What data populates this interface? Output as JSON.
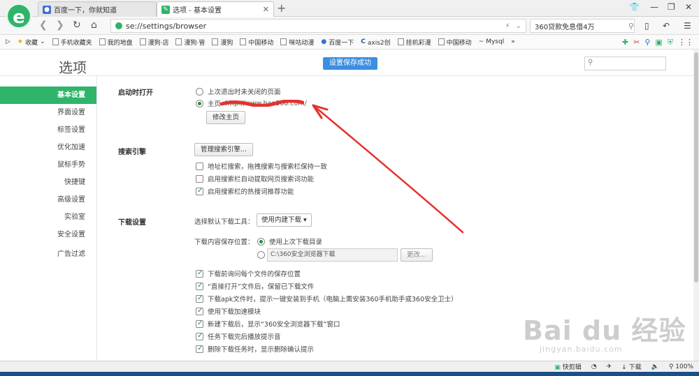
{
  "tabs": [
    {
      "label": "百度一下，你就知道",
      "active": false
    },
    {
      "label": "选项 - 基本设置",
      "active": true
    }
  ],
  "address": {
    "url": "se://settings/browser"
  },
  "search_box": {
    "text": "360贷款免息借4万"
  },
  "bookmarks": [
    "收藏",
    "手机收藏夹",
    "我的地盘",
    "漫狗·店",
    "漫狗·管",
    "漫狗",
    "中国移动",
    "咪咕动漫",
    "百度一下",
    "axis2创",
    "挂机彩漫",
    "中国移动",
    "Mysql"
  ],
  "page": {
    "title": "选项",
    "toast": "设置保存成功",
    "search_placeholder": ""
  },
  "sidebar": [
    {
      "label": "基本设置",
      "active": true
    },
    {
      "label": "界面设置",
      "active": false
    },
    {
      "label": "标签设置",
      "active": false
    },
    {
      "label": "优化加速",
      "active": false
    },
    {
      "label": "鼠标手势",
      "active": false
    },
    {
      "label": "快捷键",
      "active": false
    },
    {
      "label": "高级设置",
      "active": false
    },
    {
      "label": "实验室",
      "active": false
    },
    {
      "label": "安全设置",
      "active": false
    },
    {
      "label": "广告过滤",
      "active": false
    }
  ],
  "startup": {
    "title": "启动时打开",
    "option_restore": "上次退出时未关闭的页面",
    "option_home": "主页",
    "home_url": "http://www.hao360.com/",
    "modify_button": "修改主页"
  },
  "search_engine": {
    "title": "搜索引擎",
    "manage_button": "管理搜索引擎...",
    "options": [
      {
        "label": "地址栏搜索，拖拽搜索与搜索栏保持一致",
        "checked": false
      },
      {
        "label": "启用搜索栏自动提取网页搜索词功能",
        "checked": false
      },
      {
        "label": "启用搜索栏的热搜词推荐功能",
        "checked": true
      }
    ]
  },
  "download": {
    "title": "下载设置",
    "tool_label": "选择默认下载工具：",
    "tool_value": "使用内建下载",
    "location_label": "下载内容保存位置：",
    "location_last": "使用上次下载目录",
    "location_path": "C:\\360安全浏览器下载",
    "change_button": "更改...",
    "options": [
      {
        "label": "下载前询问每个文件的保存位置",
        "checked": true
      },
      {
        "label": "“直接打开”文件后，保留已下载文件",
        "checked": true
      },
      {
        "label": "下载apk文件时，提示一键安装到手机（电脑上需安装360手机助手或360安全卫士）",
        "checked": true
      },
      {
        "label": "使用下载加速模块",
        "checked": true
      },
      {
        "label": "新建下载后，显示“360安全浏览器下载”窗口",
        "checked": true
      },
      {
        "label": "任务下载完后播放提示音",
        "checked": true
      },
      {
        "label": "删除下载任务时，显示删除确认提示",
        "checked": true
      }
    ]
  },
  "statusbar": {
    "quick_cut": "快剪辑",
    "download": "下载",
    "zoom": "100%"
  },
  "watermark": {
    "brand": "Bai du 经验",
    "url": "jingyan.baidu.com"
  },
  "colors": {
    "accent": "#2fb46a",
    "toast": "#3b8fe0",
    "annotation": "#e5322d"
  }
}
